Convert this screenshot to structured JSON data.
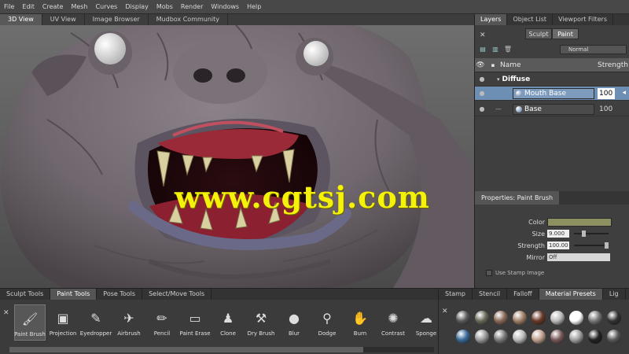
{
  "menu": [
    "File",
    "Edit",
    "Create",
    "Mesh",
    "Curves",
    "Display",
    "Mobs",
    "Render",
    "Windows",
    "Help"
  ],
  "view_tabs": [
    "3D View",
    "UV View",
    "Image Browser",
    "Mudbox Community"
  ],
  "watermark": "www.cgtsj.com",
  "right_tabs": [
    "Layers",
    "Object List",
    "Viewport Filters"
  ],
  "mode": {
    "sculpt": "Sculpt",
    "paint": "Paint"
  },
  "blend_mode": "Normal",
  "layers": {
    "col_name": "Name",
    "col_strength": "Strength",
    "group": "Diffuse",
    "rows": [
      {
        "name": "Mouth Base",
        "value": "100",
        "selected": true
      },
      {
        "name": "Base",
        "value": "100",
        "selected": false
      }
    ]
  },
  "properties": {
    "title": "Properties: Paint Brush",
    "color_label": "Color",
    "color": "#8d9060",
    "size_label": "Size",
    "size_value": "9.000",
    "strength_label": "Strength",
    "strength_value": "100.00",
    "mirror_label": "Mirror",
    "mirror_value": "Off",
    "stamp_label": "Use Stamp Image"
  },
  "tray_tabs": [
    "Sculpt Tools",
    "Paint Tools",
    "Pose Tools",
    "Select/Move Tools"
  ],
  "tools": [
    {
      "label": "Paint Brush",
      "icon": "paint-brush-icon",
      "glyph": "🖌"
    },
    {
      "label": "Projection",
      "icon": "projection-icon",
      "glyph": "▣"
    },
    {
      "label": "Eyedropper",
      "icon": "eyedropper-icon",
      "glyph": "✎"
    },
    {
      "label": "Airbrush",
      "icon": "airbrush-icon",
      "glyph": "✈"
    },
    {
      "label": "Pencil",
      "icon": "pencil-icon",
      "glyph": "✏"
    },
    {
      "label": "Paint Erase",
      "icon": "eraser-icon",
      "glyph": "▭"
    },
    {
      "label": "Clone",
      "icon": "clone-stamp-icon",
      "glyph": "♟"
    },
    {
      "label": "Dry Brush",
      "icon": "dry-brush-icon",
      "glyph": "⚒"
    },
    {
      "label": "Blur",
      "icon": "blur-drop-icon",
      "glyph": "●"
    },
    {
      "label": "Dodge",
      "icon": "dodge-icon",
      "glyph": "⚲"
    },
    {
      "label": "Burn",
      "icon": "burn-icon",
      "glyph": "✋"
    },
    {
      "label": "Contrast",
      "icon": "contrast-icon",
      "glyph": "✺"
    },
    {
      "label": "Sponge",
      "icon": "sponge-icon",
      "glyph": "☁"
    }
  ],
  "stamp_tabs": [
    "Stamp",
    "Stencil",
    "Falloff",
    "Material Presets",
    "Lig"
  ],
  "sphere_colors": [
    "#5a5a5a",
    "#6a6a5a",
    "#8a6a5a",
    "#a08068",
    "#6a3a2a",
    "#bbbbbb",
    "#ffffff",
    "#777777",
    "#333333",
    "#3a6a9a",
    "#999999",
    "#7a7a7a",
    "#bbbbbb",
    "#c0a090",
    "#7a5a5a",
    "#a0a0a0",
    "#222222",
    "#5a5a5a"
  ]
}
